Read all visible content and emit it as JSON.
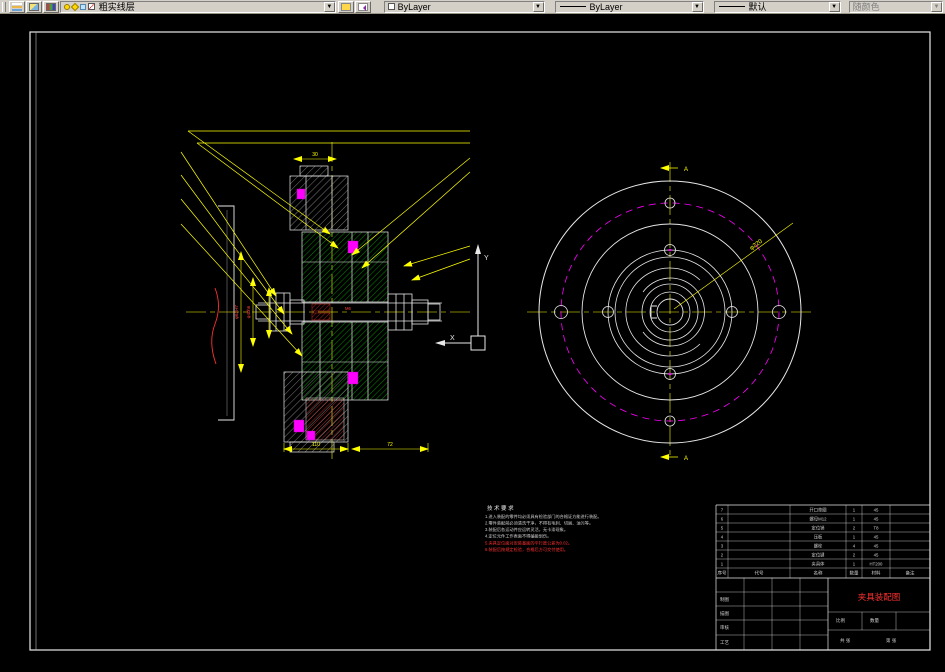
{
  "toolbar": {
    "layer": {
      "value": "粗实线层"
    },
    "color": {
      "value": "ByLayer"
    },
    "linetype": {
      "value": "ByLayer"
    },
    "lineweight": {
      "value": "默认"
    },
    "plot_style": {
      "value": "随颜色"
    }
  },
  "colors": {
    "outline": "#e8e8e8",
    "centerline": "#ffff00",
    "hatch_green": "#00c000",
    "hatch_red": "#ff3030",
    "fastener_magenta": "#ff00ff",
    "title_red": "#ff3030",
    "toolbar_bg": "#d4d0c8"
  },
  "drawing": {
    "ucs": {
      "x_label": "X",
      "y_label": "Y"
    },
    "front_view": {
      "diag_dim": "φ220",
      "section_label_top": "A",
      "section_label_bottom": "A"
    },
    "section_view": {
      "labels": {
        "dim_top": "30",
        "dim_left_1": "φ62H7",
        "dim_left_2": "φ40h6",
        "center": "M6",
        "dim_bottom_1": "110",
        "dim_bottom_2": "72"
      }
    },
    "notes": {
      "title": "技 术 要 求",
      "lines": [
        {
          "text": "1.进入装配的零件均必须具有检验部门的合格证方能进行装配。",
          "color": "#cfcfcf"
        },
        {
          "text": "2.零件装配前必须清洗干净，不得有毛刺、切屑、油污等。",
          "color": "#cfcfcf"
        },
        {
          "text": "3.装配后各运动件应运转灵活，无卡滞现象。",
          "color": "#cfcfcf"
        },
        {
          "text": "4.定位元件工作表面不得磕碰划伤。",
          "color": "#cfcfcf"
        },
        {
          "text": "5.夹具定位面对安装基面的平行度公差为0.02。",
          "color": "#ff3030"
        },
        {
          "text": "6.装配后按规定检验，合格后方可交付使用。",
          "color": "#ff3030"
        }
      ]
    },
    "title_block": {
      "drawing_name": "夹具装配图",
      "bom_header": [
        "序号",
        "代号",
        "名称",
        "数量",
        "材料",
        "备注"
      ],
      "bom_rows": [
        [
          "7",
          "",
          "开口垫圈",
          "1",
          "45",
          ""
        ],
        [
          "6",
          "",
          "螺母M12",
          "1",
          "45",
          ""
        ],
        [
          "5",
          "",
          "定位销",
          "2",
          "T8",
          ""
        ],
        [
          "4",
          "",
          "压板",
          "1",
          "45",
          ""
        ],
        [
          "3",
          "",
          "螺栓",
          "4",
          "45",
          ""
        ],
        [
          "2",
          "",
          "定位键",
          "2",
          "45",
          ""
        ],
        [
          "1",
          "",
          "夹具体",
          "1",
          "HT200",
          ""
        ]
      ],
      "fields": {
        "zhitu": "制图",
        "miaotu": "描图",
        "shenhe": "审核",
        "gongyi": "工艺",
        "bili": "比例",
        "shuliang": "数量",
        "gongzhang": "共 张",
        "dizhang": "第 张"
      }
    }
  }
}
